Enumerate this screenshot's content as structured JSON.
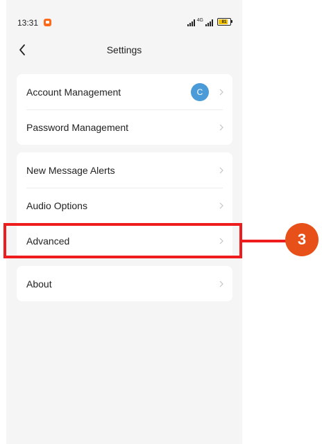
{
  "status_bar": {
    "time": "13:31",
    "network": "4G",
    "battery": "81",
    "battery_level": 0.81
  },
  "header": {
    "title": "Settings",
    "back_icon": "chevron-left-icon"
  },
  "groups": [
    {
      "items": [
        {
          "label": "Account Management",
          "avatar": "C",
          "avatar_color": "#4a9bd8"
        },
        {
          "label": "Password Management"
        }
      ]
    },
    {
      "items": [
        {
          "label": "New Message Alerts"
        },
        {
          "label": "Audio Options"
        },
        {
          "label": "Advanced"
        }
      ]
    },
    {
      "items": [
        {
          "label": "About"
        }
      ]
    }
  ],
  "annotation": {
    "step_number": "3",
    "target": "Advanced",
    "color": "#ee1c1c",
    "badge_color": "#e8501a"
  }
}
